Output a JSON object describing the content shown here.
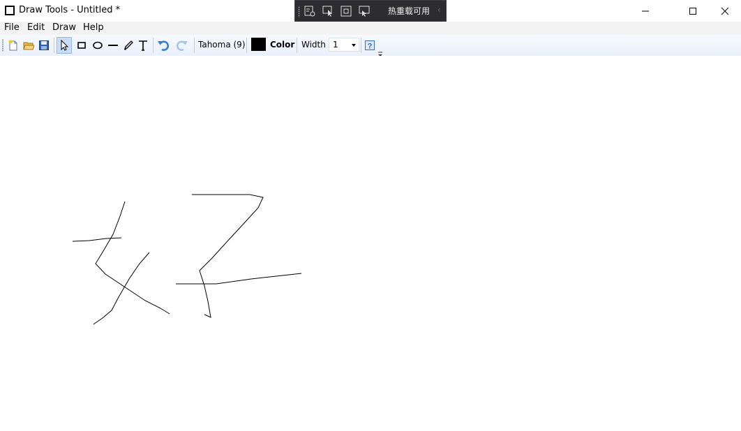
{
  "window": {
    "title": "Draw Tools - Untitled *"
  },
  "debug_toolbar": {
    "hot_reload_label": "热重载可用"
  },
  "menu": {
    "items": [
      "File",
      "Edit",
      "Draw",
      "Help"
    ]
  },
  "toolbar": {
    "font_label": "Tahoma (9)",
    "color_label": "Color",
    "width_label": "Width",
    "width_value": "1",
    "current_color": "#000000"
  },
  "colors": {
    "toolbar_bg": "#e8f0fb",
    "debug_bg": "#2d2d30",
    "active_tool": "#c9dcf5"
  }
}
